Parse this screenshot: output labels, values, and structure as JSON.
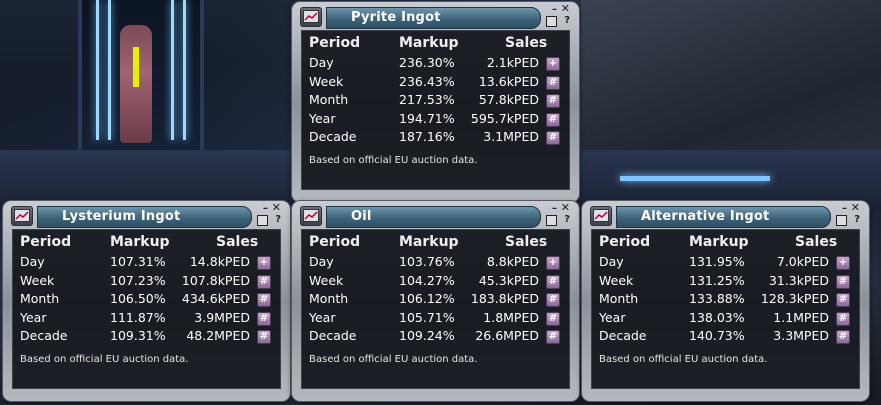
{
  "colors": {
    "accent": "#4a7088",
    "button": "#a784ad"
  },
  "panels": [
    {
      "title": "Pyrite Ingot",
      "headers": {
        "period": "Period",
        "markup": "Markup",
        "sales": "Sales"
      },
      "rows": [
        {
          "period": "Day",
          "markup": "236.30%",
          "sales": "2.1kPED",
          "btn": "+"
        },
        {
          "period": "Week",
          "markup": "236.43%",
          "sales": "13.6kPED",
          "btn": "++"
        },
        {
          "period": "Month",
          "markup": "217.53%",
          "sales": "57.8kPED",
          "btn": "+++"
        },
        {
          "period": "Year",
          "markup": "194.71%",
          "sales": "595.7kPED",
          "btn": "++++"
        },
        {
          "period": "Decade",
          "markup": "187.16%",
          "sales": "3.1MPED",
          "btn": "+++++"
        }
      ],
      "note": "Based on official EU auction data."
    },
    {
      "title": "Lysterium Ingot",
      "headers": {
        "period": "Period",
        "markup": "Markup",
        "sales": "Sales"
      },
      "rows": [
        {
          "period": "Day",
          "markup": "107.31%",
          "sales": "14.8kPED",
          "btn": "+"
        },
        {
          "period": "Week",
          "markup": "107.23%",
          "sales": "107.8kPED",
          "btn": "++"
        },
        {
          "period": "Month",
          "markup": "106.50%",
          "sales": "434.6kPED",
          "btn": "+++"
        },
        {
          "period": "Year",
          "markup": "111.87%",
          "sales": "3.9MPED",
          "btn": "++++"
        },
        {
          "period": "Decade",
          "markup": "109.31%",
          "sales": "48.2MPED",
          "btn": "+++++"
        }
      ],
      "note": "Based on official EU auction data."
    },
    {
      "title": "Oil",
      "headers": {
        "period": "Period",
        "markup": "Markup",
        "sales": "Sales"
      },
      "rows": [
        {
          "period": "Day",
          "markup": "103.76%",
          "sales": "8.8kPED",
          "btn": "+"
        },
        {
          "period": "Week",
          "markup": "104.27%",
          "sales": "45.3kPED",
          "btn": "++"
        },
        {
          "period": "Month",
          "markup": "106.12%",
          "sales": "183.8kPED",
          "btn": "+++"
        },
        {
          "period": "Year",
          "markup": "105.71%",
          "sales": "1.8MPED",
          "btn": "++++"
        },
        {
          "period": "Decade",
          "markup": "109.24%",
          "sales": "26.6MPED",
          "btn": "+++++"
        }
      ],
      "note": "Based on official EU auction data."
    },
    {
      "title": "Alternative Ingot",
      "headers": {
        "period": "Period",
        "markup": "Markup",
        "sales": "Sales"
      },
      "rows": [
        {
          "period": "Day",
          "markup": "131.95%",
          "sales": "7.0kPED",
          "btn": "+"
        },
        {
          "period": "Week",
          "markup": "131.25%",
          "sales": "31.3kPED",
          "btn": "++"
        },
        {
          "period": "Month",
          "markup": "133.88%",
          "sales": "128.3kPED",
          "btn": "+++"
        },
        {
          "period": "Year",
          "markup": "138.03%",
          "sales": "1.1MPED",
          "btn": "++++"
        },
        {
          "period": "Decade",
          "markup": "140.73%",
          "sales": "3.3MPED",
          "btn": "+++++"
        }
      ],
      "note": "Based on official EU auction data."
    }
  ],
  "controls": {
    "minimize": "–",
    "close": "✕",
    "help": "?"
  }
}
